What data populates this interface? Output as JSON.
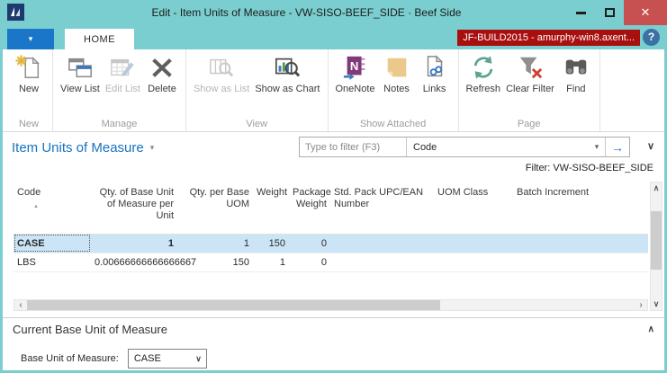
{
  "window": {
    "title": "Edit - Item Units of Measure - VW-SISO-BEEF_SIDE · Beef Side"
  },
  "tabbar": {
    "home": "HOME",
    "server_badge": "JF-BUILD2015 - amurphy-win8.axent...",
    "help": "?"
  },
  "ribbon": {
    "new": "New",
    "view_list": "View List",
    "edit_list": "Edit List",
    "delete": "Delete",
    "show_as_list": "Show as List",
    "show_as_chart": "Show as Chart",
    "onenote": "OneNote",
    "notes": "Notes",
    "links": "Links",
    "refresh": "Refresh",
    "clear_filter": "Clear Filter",
    "find": "Find",
    "groups": {
      "new": "New",
      "manage": "Manage",
      "view": "View",
      "show_attached": "Show Attached",
      "page": "Page"
    }
  },
  "content": {
    "page_title": "Item Units of Measure",
    "filter_placeholder": "Type to filter (F3)",
    "filter_column": "Code",
    "filter_info": "Filter: VW-SISO-BEEF_SIDE"
  },
  "table": {
    "headers": {
      "code": "Code",
      "qty_base": "Qty. of Base Unit of Measure per Unit",
      "qty_per_uom": "Qty. per Base UOM",
      "weight": "Weight",
      "package_weight": "Package Weight",
      "std_pack": "Std. Pack UPC/EAN Number",
      "uom_class": "UOM Class",
      "batch_increment": "Batch Increment"
    },
    "rows": [
      {
        "code": "CASE",
        "qty_base": "1",
        "qty_per_uom": "1",
        "weight": "150",
        "package_weight": "0",
        "std_pack": "",
        "uom_class": "",
        "batch_increment": ""
      },
      {
        "code": "LBS",
        "qty_base": "0.00666666666666667",
        "qty_per_uom": "150",
        "weight": "1",
        "package_weight": "0",
        "std_pack": "",
        "uom_class": "",
        "batch_increment": ""
      }
    ]
  },
  "bottom": {
    "section_title": "Current Base Unit of Measure",
    "field_label": "Base Unit of Measure:",
    "field_value": "CASE"
  },
  "icons": {
    "close": "✕",
    "dropdown": "▾",
    "sort_asc": "▲",
    "go_arrow": "→",
    "chevron_up": "∧",
    "chevron_down": "∨",
    "scroll_left": "‹",
    "scroll_right": "›",
    "onenote_letter": "N"
  },
  "colors": {
    "titlebar_teal": "#7BCED0",
    "close_red": "#C75050",
    "accent_blue": "#1976C8",
    "badge_red": "#A80F0F",
    "page_title_blue": "#1772C0",
    "selected_row": "#CCE5F6"
  }
}
